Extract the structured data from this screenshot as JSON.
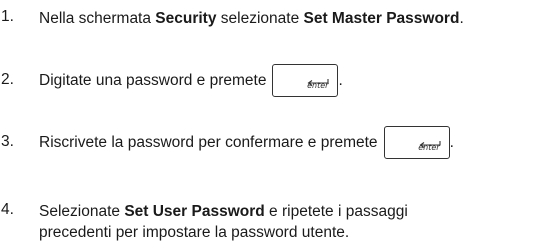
{
  "steps": [
    {
      "number": "1.",
      "parts": [
        "Nella schermata ",
        "Security",
        " selezionate ",
        "Set Master Password",
        "."
      ]
    },
    {
      "number": "2.",
      "parts": [
        "Digitate una password e premete",
        "."
      ]
    },
    {
      "number": "3.",
      "parts": [
        "Riscrivete la password per confermare e premete",
        "."
      ]
    },
    {
      "number": "4.",
      "parts": [
        "Selezionate ",
        "Set User Password",
        " e ripetete i passaggi",
        "precedenti per impostare la password utente."
      ]
    }
  ],
  "key": {
    "label": "enter",
    "icon": "enter-key-icon"
  }
}
